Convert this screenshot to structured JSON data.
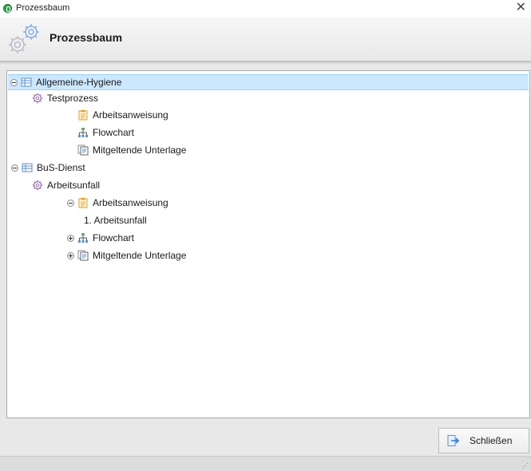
{
  "window": {
    "title": "Prozessbaum",
    "close_glyph": "✕"
  },
  "header": {
    "title": "Prozessbaum",
    "icon": "gears-icon"
  },
  "tree": [
    {
      "label": "Allgemeine-Hygiene",
      "icon": "table-icon",
      "toggle": "collapse",
      "level": 0,
      "selected": true
    },
    {
      "label": "Testprozess",
      "icon": "gear-icon",
      "level": 1
    },
    {
      "label": "Arbeitsanweisung",
      "icon": "clipboard-icon",
      "level": 3
    },
    {
      "label": "Flowchart",
      "icon": "flowchart-icon",
      "level": 3
    },
    {
      "label": "Mitgeltende Unterlage",
      "icon": "documents-icon",
      "level": 3
    },
    {
      "label": "BuS-Dienst",
      "icon": "table-icon",
      "toggle": "collapse",
      "level": 0
    },
    {
      "label": "Arbeitsunfall",
      "icon": "gear-icon",
      "level": 1
    },
    {
      "label": "Arbeitsanweisung",
      "icon": "clipboard-icon",
      "toggle": "collapse",
      "level": 2
    },
    {
      "label": "1. Arbeitsunfall",
      "level": 3
    },
    {
      "label": "Flowchart",
      "icon": "flowchart-icon",
      "toggle": "expand",
      "level": 2
    },
    {
      "label": "Mitgeltende Unterlage",
      "icon": "documents-icon",
      "toggle": "expand",
      "level": 2
    }
  ],
  "footer": {
    "close_button_label": "Schließen",
    "close_button_icon": "exit-arrow-icon"
  }
}
